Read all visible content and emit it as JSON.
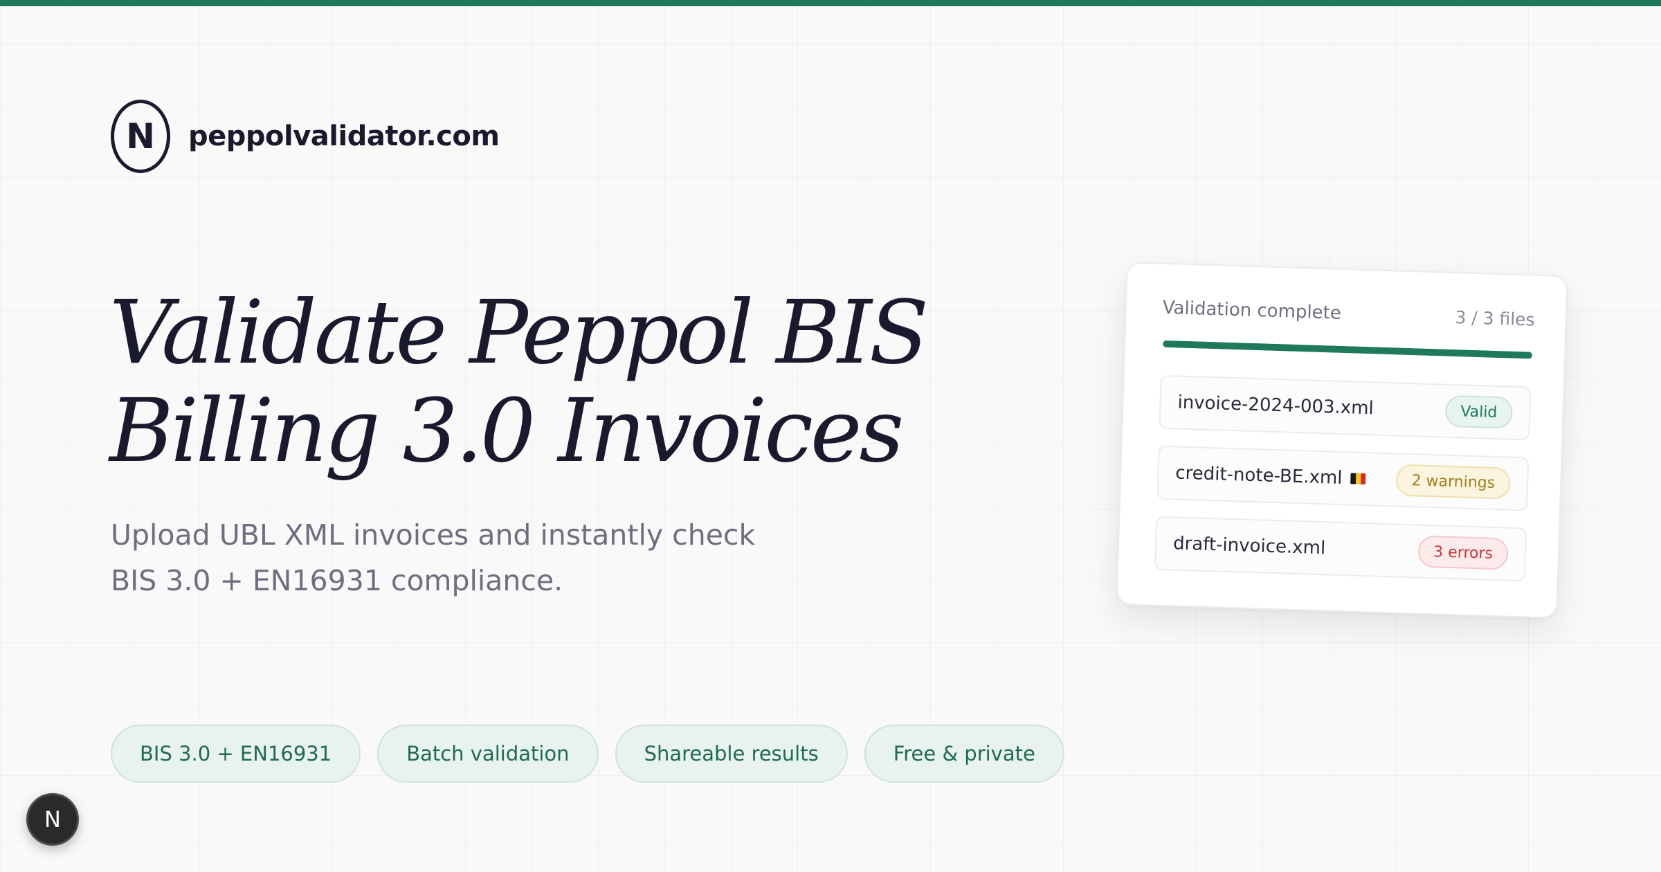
{
  "brand": {
    "logo_letter": "N",
    "name": "peppolvalidator.com"
  },
  "hero": {
    "title_line1": "Validate Peppol BIS",
    "title_line2": "Billing 3.0 Invoices",
    "subtitle_line1": "Upload UBL XML invoices and instantly check",
    "subtitle_line2": "BIS 3.0 + EN16931 compliance."
  },
  "features": [
    {
      "label": "BIS 3.0 + EN16931"
    },
    {
      "label": "Batch validation"
    },
    {
      "label": "Shareable results"
    },
    {
      "label": "Free & private"
    }
  ],
  "validation_card": {
    "title": "Validation complete",
    "count": "3 / 3 files",
    "progress": 1.0,
    "files": [
      {
        "name": "invoice-2024-003.xml",
        "status": "Valid",
        "status_type": "valid",
        "flag": ""
      },
      {
        "name": "credit-note-BE.xml",
        "status": "2 warnings",
        "status_type": "warning",
        "flag": "belgium-flag-icon"
      },
      {
        "name": "draft-invoice.xml",
        "status": "3 errors",
        "status_type": "error",
        "flag": ""
      }
    ]
  },
  "floating_button": {
    "letter": "N"
  },
  "colors": {
    "accent": "#1f7a5a",
    "valid": "#1f7a5a",
    "warning": "#a07d1c",
    "error": "#c23a3a"
  }
}
